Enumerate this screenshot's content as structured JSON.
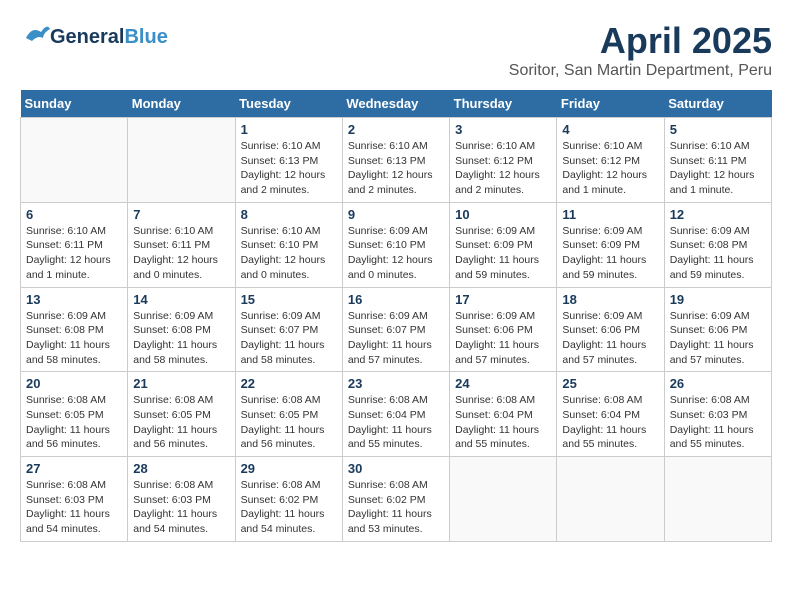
{
  "header": {
    "logo_general": "General",
    "logo_blue": "Blue",
    "month": "April 2025",
    "location": "Soritor, San Martin Department, Peru"
  },
  "days_of_week": [
    "Sunday",
    "Monday",
    "Tuesday",
    "Wednesday",
    "Thursday",
    "Friday",
    "Saturday"
  ],
  "weeks": [
    [
      {
        "day": "",
        "info": ""
      },
      {
        "day": "",
        "info": ""
      },
      {
        "day": "1",
        "info": "Sunrise: 6:10 AM\nSunset: 6:13 PM\nDaylight: 12 hours\nand 2 minutes."
      },
      {
        "day": "2",
        "info": "Sunrise: 6:10 AM\nSunset: 6:13 PM\nDaylight: 12 hours\nand 2 minutes."
      },
      {
        "day": "3",
        "info": "Sunrise: 6:10 AM\nSunset: 6:12 PM\nDaylight: 12 hours\nand 2 minutes."
      },
      {
        "day": "4",
        "info": "Sunrise: 6:10 AM\nSunset: 6:12 PM\nDaylight: 12 hours\nand 1 minute."
      },
      {
        "day": "5",
        "info": "Sunrise: 6:10 AM\nSunset: 6:11 PM\nDaylight: 12 hours\nand 1 minute."
      }
    ],
    [
      {
        "day": "6",
        "info": "Sunrise: 6:10 AM\nSunset: 6:11 PM\nDaylight: 12 hours\nand 1 minute."
      },
      {
        "day": "7",
        "info": "Sunrise: 6:10 AM\nSunset: 6:11 PM\nDaylight: 12 hours\nand 0 minutes."
      },
      {
        "day": "8",
        "info": "Sunrise: 6:10 AM\nSunset: 6:10 PM\nDaylight: 12 hours\nand 0 minutes."
      },
      {
        "day": "9",
        "info": "Sunrise: 6:09 AM\nSunset: 6:10 PM\nDaylight: 12 hours\nand 0 minutes."
      },
      {
        "day": "10",
        "info": "Sunrise: 6:09 AM\nSunset: 6:09 PM\nDaylight: 11 hours\nand 59 minutes."
      },
      {
        "day": "11",
        "info": "Sunrise: 6:09 AM\nSunset: 6:09 PM\nDaylight: 11 hours\nand 59 minutes."
      },
      {
        "day": "12",
        "info": "Sunrise: 6:09 AM\nSunset: 6:08 PM\nDaylight: 11 hours\nand 59 minutes."
      }
    ],
    [
      {
        "day": "13",
        "info": "Sunrise: 6:09 AM\nSunset: 6:08 PM\nDaylight: 11 hours\nand 58 minutes."
      },
      {
        "day": "14",
        "info": "Sunrise: 6:09 AM\nSunset: 6:08 PM\nDaylight: 11 hours\nand 58 minutes."
      },
      {
        "day": "15",
        "info": "Sunrise: 6:09 AM\nSunset: 6:07 PM\nDaylight: 11 hours\nand 58 minutes."
      },
      {
        "day": "16",
        "info": "Sunrise: 6:09 AM\nSunset: 6:07 PM\nDaylight: 11 hours\nand 57 minutes."
      },
      {
        "day": "17",
        "info": "Sunrise: 6:09 AM\nSunset: 6:06 PM\nDaylight: 11 hours\nand 57 minutes."
      },
      {
        "day": "18",
        "info": "Sunrise: 6:09 AM\nSunset: 6:06 PM\nDaylight: 11 hours\nand 57 minutes."
      },
      {
        "day": "19",
        "info": "Sunrise: 6:09 AM\nSunset: 6:06 PM\nDaylight: 11 hours\nand 57 minutes."
      }
    ],
    [
      {
        "day": "20",
        "info": "Sunrise: 6:08 AM\nSunset: 6:05 PM\nDaylight: 11 hours\nand 56 minutes."
      },
      {
        "day": "21",
        "info": "Sunrise: 6:08 AM\nSunset: 6:05 PM\nDaylight: 11 hours\nand 56 minutes."
      },
      {
        "day": "22",
        "info": "Sunrise: 6:08 AM\nSunset: 6:05 PM\nDaylight: 11 hours\nand 56 minutes."
      },
      {
        "day": "23",
        "info": "Sunrise: 6:08 AM\nSunset: 6:04 PM\nDaylight: 11 hours\nand 55 minutes."
      },
      {
        "day": "24",
        "info": "Sunrise: 6:08 AM\nSunset: 6:04 PM\nDaylight: 11 hours\nand 55 minutes."
      },
      {
        "day": "25",
        "info": "Sunrise: 6:08 AM\nSunset: 6:04 PM\nDaylight: 11 hours\nand 55 minutes."
      },
      {
        "day": "26",
        "info": "Sunrise: 6:08 AM\nSunset: 6:03 PM\nDaylight: 11 hours\nand 55 minutes."
      }
    ],
    [
      {
        "day": "27",
        "info": "Sunrise: 6:08 AM\nSunset: 6:03 PM\nDaylight: 11 hours\nand 54 minutes."
      },
      {
        "day": "28",
        "info": "Sunrise: 6:08 AM\nSunset: 6:03 PM\nDaylight: 11 hours\nand 54 minutes."
      },
      {
        "day": "29",
        "info": "Sunrise: 6:08 AM\nSunset: 6:02 PM\nDaylight: 11 hours\nand 54 minutes."
      },
      {
        "day": "30",
        "info": "Sunrise: 6:08 AM\nSunset: 6:02 PM\nDaylight: 11 hours\nand 53 minutes."
      },
      {
        "day": "",
        "info": ""
      },
      {
        "day": "",
        "info": ""
      },
      {
        "day": "",
        "info": ""
      }
    ]
  ]
}
